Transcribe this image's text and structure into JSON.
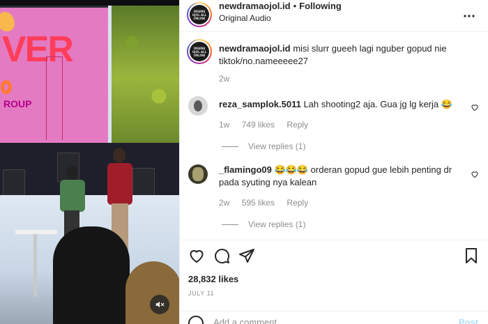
{
  "post": {
    "author": "newdramaojol.id",
    "follow_status": "Following",
    "audio": "Original Audio",
    "avatar_text": "DRAMA OJOL ALL ONLINE",
    "caption": {
      "username": "newdramaojol.id",
      "text": "misi slurr gueeh lagi nguber gopud nie tiktok/no.nameeeee27",
      "age": "2w"
    },
    "likes": "28,832 likes",
    "date": "JULY 11"
  },
  "media": {
    "screen_text_1": "VER",
    "screen_text_2": "ROUP"
  },
  "comments": [
    {
      "username": "reza_samplok.5011",
      "text": "Lah shooting2 aja. Gua jg lg kerja 😂",
      "age": "1w",
      "likes": "749 likes",
      "reply_label": "Reply",
      "view_replies": "View replies (1)"
    },
    {
      "username": "_flamingo09",
      "text": "😂😂😂 orderan gopud gue lebih penting dr pada syuting nya kalean",
      "age": "2w",
      "likes": "595 likes",
      "reply_label": "Reply",
      "view_replies": "View replies (1)"
    }
  ],
  "comment_box": {
    "placeholder": "Add a comment…",
    "post_label": "Post"
  },
  "icons": {
    "more": "more-options-icon",
    "like": "heart-icon",
    "comment": "comment-icon",
    "share": "share-icon",
    "save": "bookmark-icon",
    "mute": "muted-speaker-icon",
    "emoji": "emoji-icon"
  },
  "colors": {
    "text": "#262626",
    "secondary": "#8e8e8e",
    "post_disabled": "#b2dffc",
    "divider": "#efefef"
  }
}
